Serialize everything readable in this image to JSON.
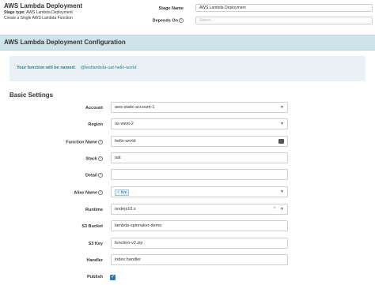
{
  "header": {
    "title": "AWS Lambda Deployment",
    "stage_type_label": "Stage type:",
    "stage_type_value": "AWS Lambda Deployment",
    "description": "Create a Single AWS Lambda Function",
    "stage_name_label": "Stage Name",
    "stage_name_value": "AWS Lambda Deployment",
    "depends_on_label": "Depends On",
    "depends_on_placeholder": "Select..."
  },
  "config": {
    "title": "AWS Lambda Deployment Configuration",
    "notice_label": "Your function will be named:",
    "notice_value": "@testlambda-uat-hello-world"
  },
  "basic": {
    "title": "Basic Settings",
    "fields": {
      "account": {
        "label": "Account",
        "value": "aws-static-account-1"
      },
      "region": {
        "label": "Region",
        "value": "us-west-2"
      },
      "function_name": {
        "label": "Function Name",
        "value": "hello-world"
      },
      "stack": {
        "label": "Stack",
        "value": "uat"
      },
      "detail": {
        "label": "Detail",
        "value": ""
      },
      "alias_name": {
        "label": "Alias Name",
        "value": "live"
      },
      "runtime": {
        "label": "Runtime",
        "value": "nodejs10.x"
      },
      "s3_bucket": {
        "label": "S3 Bucket",
        "value": "lambda-spinnaker-demo"
      },
      "s3_key": {
        "label": "S3 Key",
        "value": "function-v2.zip"
      },
      "handler": {
        "label": "Handler",
        "value": "index.handler"
      },
      "publish": {
        "label": "Publish",
        "checked": true
      }
    }
  },
  "colors": {
    "accent": "#2a7ab8",
    "config_bar": "#cfe3ea",
    "notice_text": "#2d7f8a"
  },
  "icons": [
    "info-icon",
    "chevron-down-icon",
    "clear-icon",
    "checkbox-icon",
    "id-card-icon"
  ]
}
